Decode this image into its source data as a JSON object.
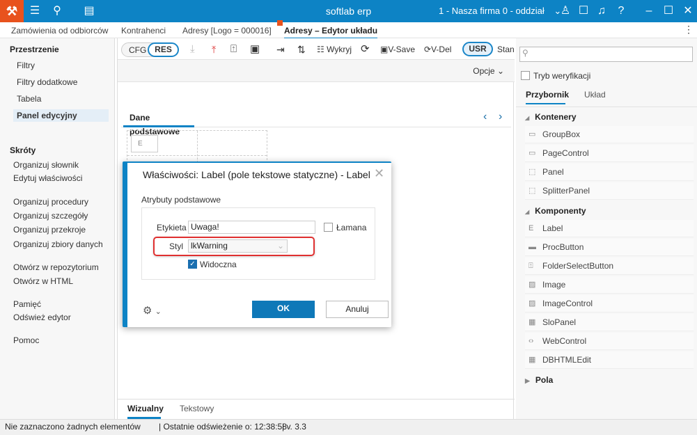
{
  "titlebar": {
    "app_title": "softlab erp",
    "company": "1 - Nasza firma 0 - oddział"
  },
  "doc_tabs": [
    "Zamówienia od odbiorców",
    "Kontrahenci",
    "Adresy [Logo = 000016]",
    "Adresy – Edytor układu"
  ],
  "sidebar": {
    "section1": "Przestrzenie",
    "items1": [
      "Filtry",
      "Filtry dodatkowe",
      "Tabela",
      "Panel edycyjny"
    ],
    "section2": "Skróty",
    "items2": [
      "Organizuj słownik",
      "Edytuj właściwości",
      "Organizuj procedury",
      "Organizuj szczegóły",
      "Organizuj przekroje",
      "Organizuj zbiory danych",
      "Otwórz w repozytorium",
      "Otwórz w HTML",
      "Pamięć",
      "Odśwież edytor",
      "Pomoc"
    ]
  },
  "toolbar": {
    "cfg": "CFG",
    "res": "RES",
    "detect": "Wykryj",
    "vsave": "V-Save",
    "vdel": "V-Del",
    "usr": "USR",
    "stan": "Stan"
  },
  "options_label": "Opcje",
  "content_tab": "Dane podstawowe",
  "bottom_tabs": [
    "Wizualny",
    "Tekstowy"
  ],
  "right": {
    "verify": "Tryb weryfikacji",
    "tabs": [
      "Przybornik",
      "Układ"
    ],
    "group1": "Kontenery",
    "items1": [
      "GroupBox",
      "PageControl",
      "Panel",
      "SplitterPanel"
    ],
    "group2": "Komponenty",
    "items2": [
      "Label",
      "ProcButton",
      "FolderSelectButton",
      "Image",
      "ImageControl",
      "SloPanel",
      "WebControl",
      "DBHTMLEdit"
    ],
    "group3": "Pola"
  },
  "dialog": {
    "title": "Właściwości: Label (pole tekstowe statyczne) - Label",
    "section": "Atrybuty podstawowe",
    "label_label": "Etykieta",
    "label_value": "Uwaga!",
    "broken": "Łamana",
    "style_label": "Styl",
    "style_value": "lkWarning",
    "visible": "Widoczna",
    "ok": "OK",
    "cancel": "Anuluj"
  },
  "status": {
    "selection": "Nie zaznaczono żadnych elementów",
    "refresh": "| Ostatnie odświeżenie o: 12:38:58",
    "version": "| v. 3.3"
  }
}
